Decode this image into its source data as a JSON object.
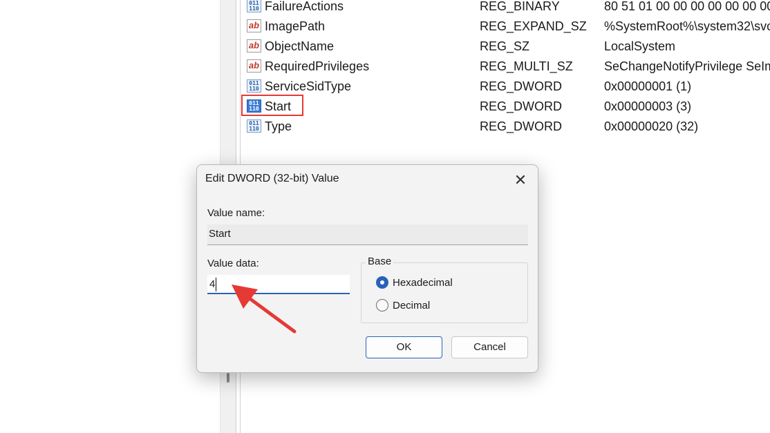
{
  "registry": {
    "rows": [
      {
        "name": "FailureActions",
        "type": "REG_BINARY",
        "data": "80 51 01 00 00 00 00 00 00 00",
        "icon": "binary-value-icon"
      },
      {
        "name": "ImagePath",
        "type": "REG_EXPAND_SZ",
        "data": "%SystemRoot%\\system32\\svc",
        "icon": "string-value-icon"
      },
      {
        "name": "ObjectName",
        "type": "REG_SZ",
        "data": "LocalSystem",
        "icon": "string-value-icon"
      },
      {
        "name": "RequiredPrivileges",
        "type": "REG_MULTI_SZ",
        "data": "SeChangeNotifyPrivilege SeIm",
        "icon": "string-value-icon"
      },
      {
        "name": "ServiceSidType",
        "type": "REG_DWORD",
        "data": "0x00000001 (1)",
        "icon": "binary-value-icon"
      },
      {
        "name": "Start",
        "type": "REG_DWORD",
        "data": "0x00000003 (3)",
        "icon": "binary-value-icon",
        "selected": true
      },
      {
        "name": "Type",
        "type": "REG_DWORD",
        "data": "0x00000020 (32)",
        "icon": "binary-value-icon"
      }
    ],
    "icon_text": {
      "string": "ab",
      "binary": "011\n110"
    }
  },
  "dialog": {
    "title": "Edit DWORD (32-bit) Value",
    "close_glyph": "✕",
    "value_name_label": "Value name:",
    "value_name": "Start",
    "value_data_label": "Value data:",
    "value_data": "4",
    "base_label": "Base",
    "radio_hex": "Hexadecimal",
    "radio_dec": "Decimal",
    "base_selected": "Hexadecimal",
    "ok_label": "OK",
    "cancel_label": "Cancel"
  },
  "colors": {
    "annotation_red": "#e53935",
    "accent_blue": "#2a62b8"
  }
}
